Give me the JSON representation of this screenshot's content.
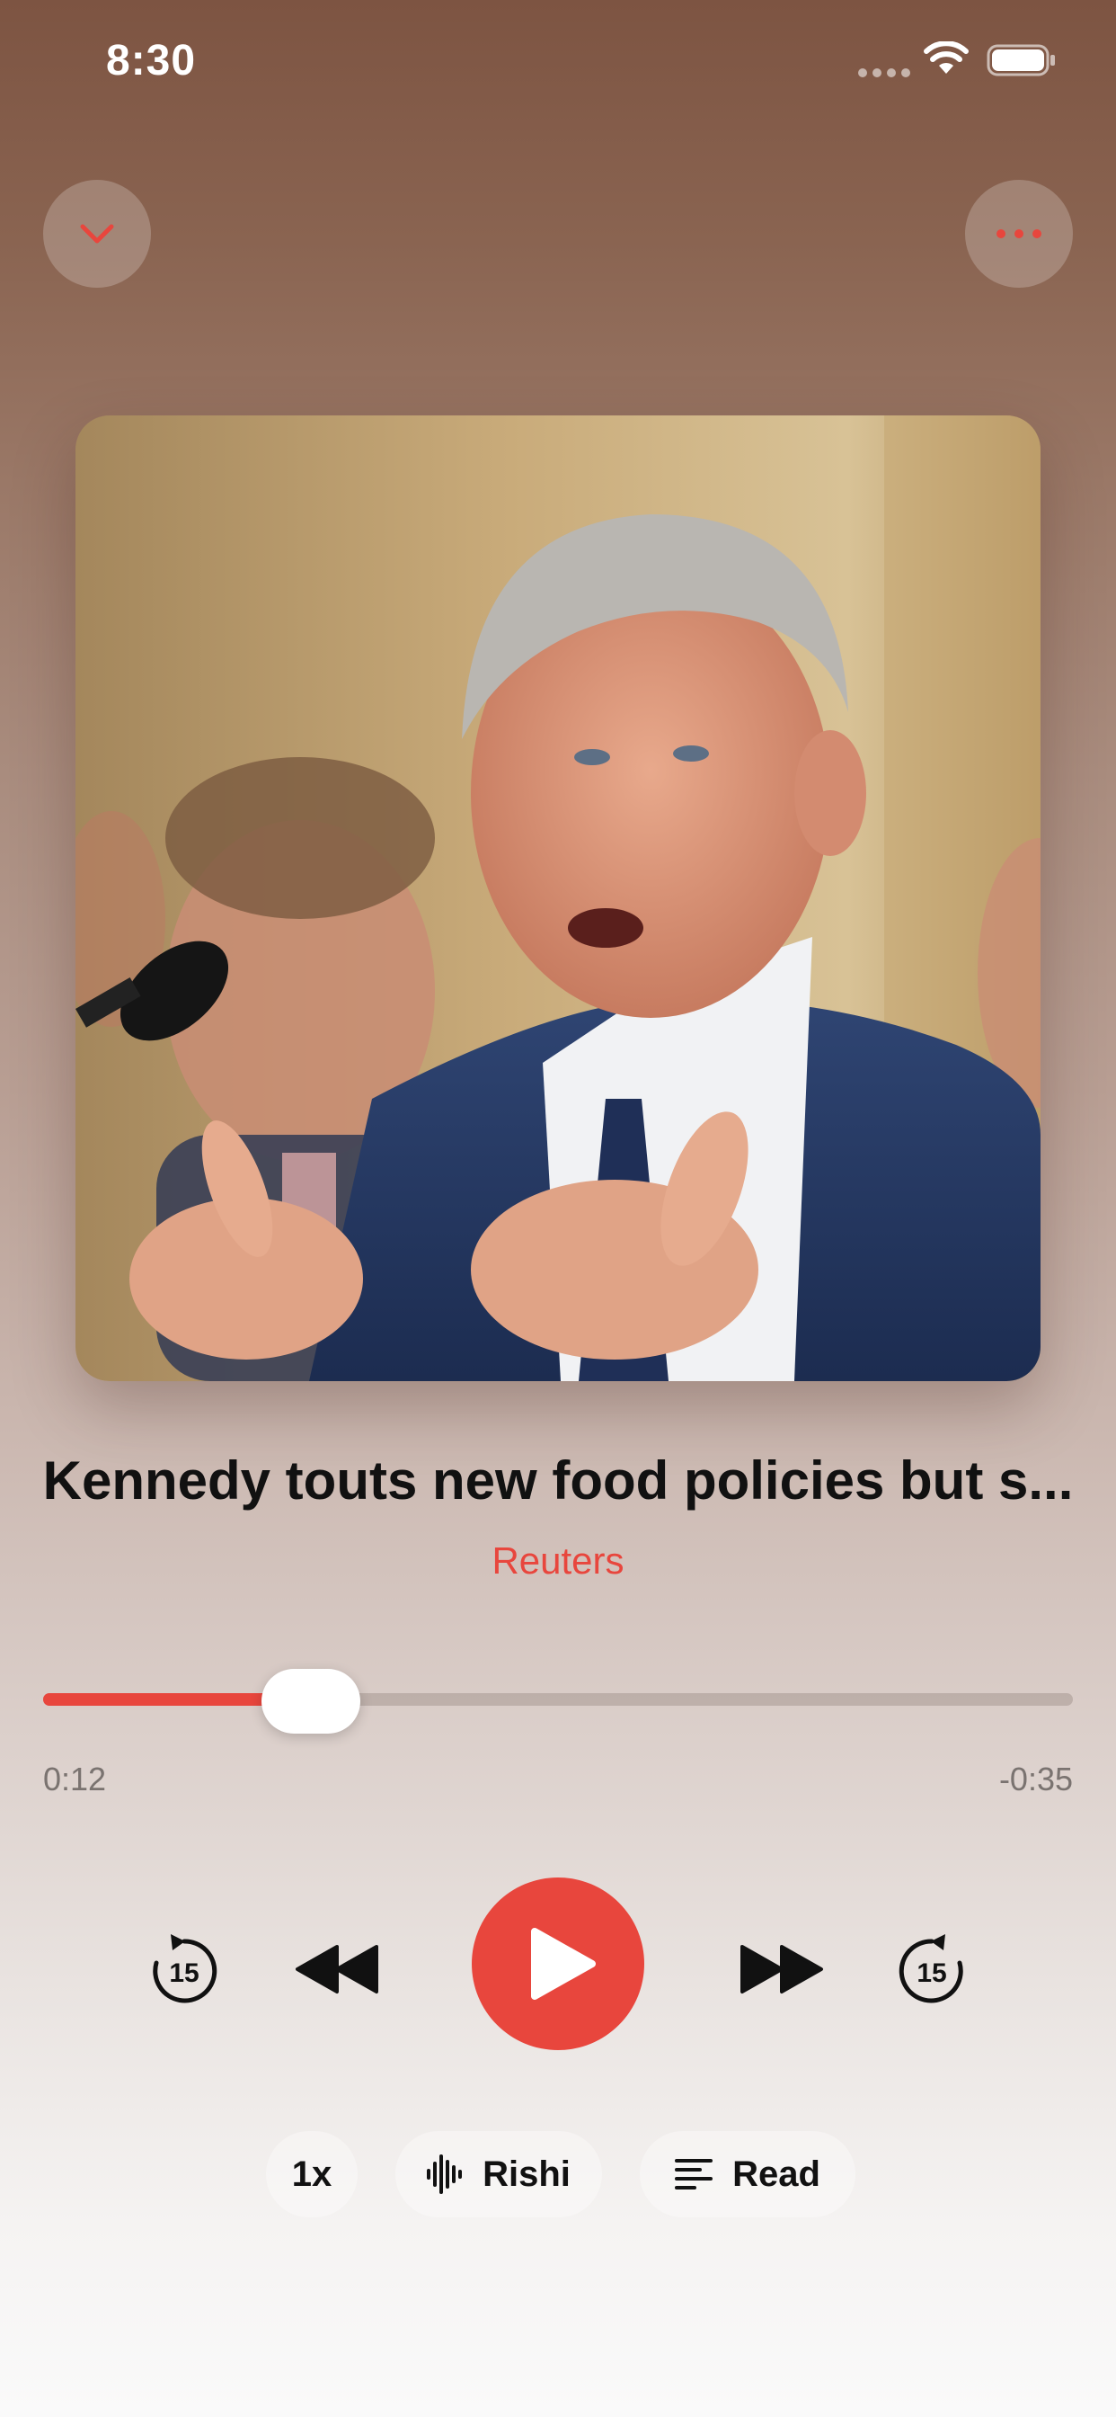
{
  "status_bar": {
    "time": "8:30"
  },
  "now_playing": {
    "title": "Kennedy touts new food policies but s...",
    "source": "Reuters",
    "elapsed": "0:12",
    "remaining": "-0:35",
    "progress_fraction": 0.26
  },
  "options": {
    "speed_label": "1x",
    "voice_label": "Rishi",
    "read_label": "Read"
  },
  "colors": {
    "accent": "#e8463d",
    "title": "#111111"
  },
  "icons": {
    "collapse": "chevron-down-icon",
    "more": "ellipsis-icon",
    "skip_back": "skip-back-15-icon",
    "rewind": "rewind-icon",
    "play": "play-icon",
    "forward": "fast-forward-icon",
    "skip_forward": "skip-forward-15-icon",
    "voice": "waveform-icon",
    "read": "text-lines-icon"
  },
  "skip_seconds": "15"
}
